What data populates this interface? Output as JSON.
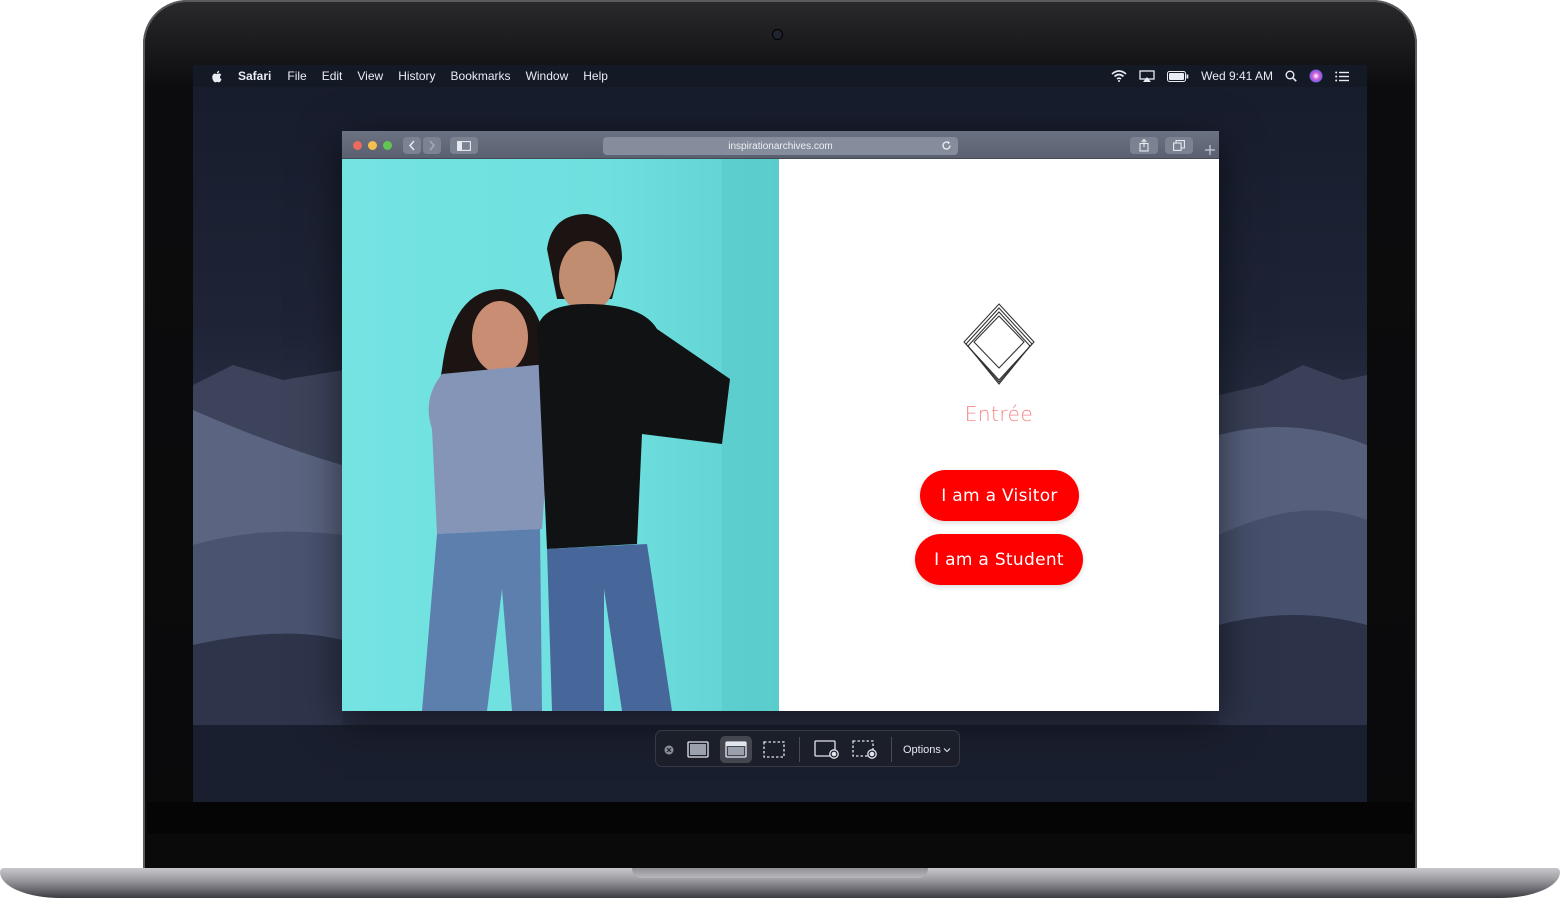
{
  "menubar": {
    "app_name": "Safari",
    "items": [
      "File",
      "Edit",
      "View",
      "History",
      "Bookmarks",
      "Window",
      "Help"
    ],
    "clock": "Wed 9:41 AM",
    "status_icons": [
      "wifi-icon",
      "airplay-icon",
      "battery-icon",
      "search-icon",
      "siri-icon",
      "notification-center-icon"
    ]
  },
  "browser": {
    "url": "inspirationarchives.com"
  },
  "page": {
    "heading": "Entrée",
    "buttons": {
      "visitor": "I am a Visitor",
      "student": "I am a Student"
    },
    "accent_color": "#fe0000",
    "heading_color": "#f3868a",
    "photo_background": "#74e3e2"
  },
  "screenshot_toolbar": {
    "options_label": "Options",
    "tools": [
      "close-icon",
      "capture-entire-screen-icon",
      "capture-window-icon",
      "capture-selection-icon",
      "record-screen-icon",
      "record-selection-icon"
    ]
  }
}
